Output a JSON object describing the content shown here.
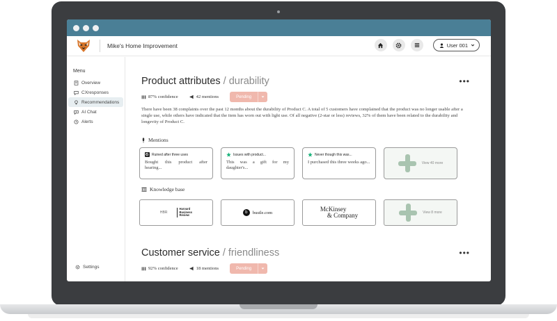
{
  "app": {
    "title": "Mike's Home Improvement",
    "user_label": "User 001"
  },
  "sidebar": {
    "heading": "Menu",
    "items": [
      {
        "label": "Overview",
        "icon": "book-icon"
      },
      {
        "label": "CXresponses",
        "icon": "chat-icon"
      },
      {
        "label": "Recommendations",
        "icon": "lightbulb-icon",
        "active": true
      },
      {
        "label": "AI Chat",
        "icon": "sparkle-chat-icon"
      },
      {
        "label": "Alerts",
        "icon": "clock-icon"
      }
    ],
    "settings_label": "Settings"
  },
  "sections": [
    {
      "title": "Product attributes",
      "subtitle": " / durability",
      "confidence": "87% confidence",
      "mentions": "42 mentions",
      "status": "Pending",
      "description": "There have been 38 complaints over the past 12 months about the durability of Product C. A total of 5 customers have complained that the product was no longer usable after a single use, while others have indicated that the item has worn out with light use. Of all negative (2-star or less) reviews, 32% of them have been related to the durability and longevity of Product C.",
      "mentions_heading": "Mentions",
      "mention_cards": [
        {
          "source_icon": "google-icon",
          "head": "Ruined after three uses",
          "text": "Bought this product after hearing..."
        },
        {
          "source_icon": "star-icon",
          "head": "Issues with product...",
          "text": "This was a gift for my daughter's..."
        },
        {
          "source_icon": "star-icon",
          "head": "Never though this was...",
          "text": "I purchased this three weeks ago..."
        }
      ],
      "mentions_more": "View 40 more",
      "kb_heading": "Knowledge base",
      "kb_cards": {
        "hbr_mark": "HBR",
        "hbr_lines": [
          "Harvard",
          "Business",
          "Review"
        ],
        "bustle_letter": "b",
        "bustle_text": "bustle.com",
        "mckinsey_lines": [
          "McKinsey",
          "& Company"
        ]
      },
      "kb_more": "View 8 more"
    },
    {
      "title": "Customer service",
      "subtitle": " / friendliness",
      "confidence": "92% confidence",
      "mentions": "18 mentions",
      "status": "Pending"
    }
  ],
  "colors": {
    "titlebar": "#4a7f96",
    "pending": "#f0b8ad",
    "plus": "#a9c4b0",
    "active_nav": "#e7eef1"
  }
}
